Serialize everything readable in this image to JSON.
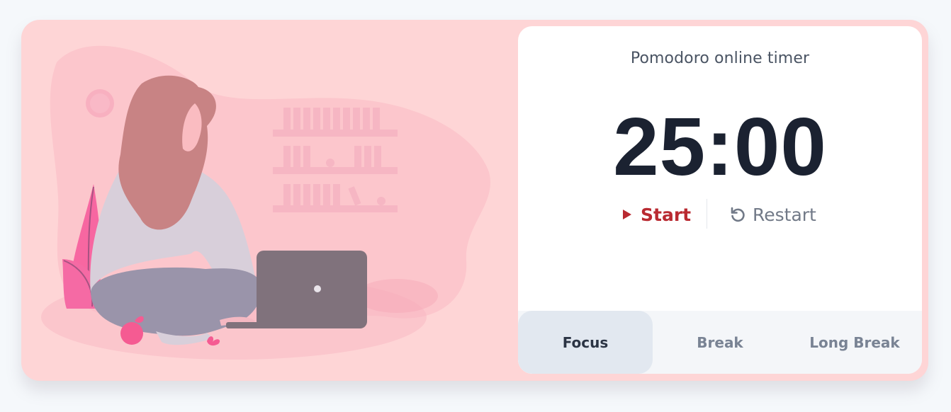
{
  "timer": {
    "title": "Pomodoro online timer",
    "time": "25:00"
  },
  "controls": {
    "start_label": "Start",
    "start_icon": "play-icon",
    "restart_label": "Restart",
    "restart_icon": "restart-icon"
  },
  "tabs": [
    {
      "label": "Focus",
      "active": true
    },
    {
      "label": "Break",
      "active": false
    },
    {
      "label": "Long Break",
      "active": false
    }
  ],
  "colors": {
    "page_background": "#f5f8fb",
    "card_background": "#fed5d6",
    "panel_background": "#ffffff",
    "timer_text": "#1b2231",
    "start_accent": "#b92a31",
    "muted_text": "#717987",
    "active_tab_background": "#e2e8f0",
    "tabs_background": "#f4f6f9"
  }
}
